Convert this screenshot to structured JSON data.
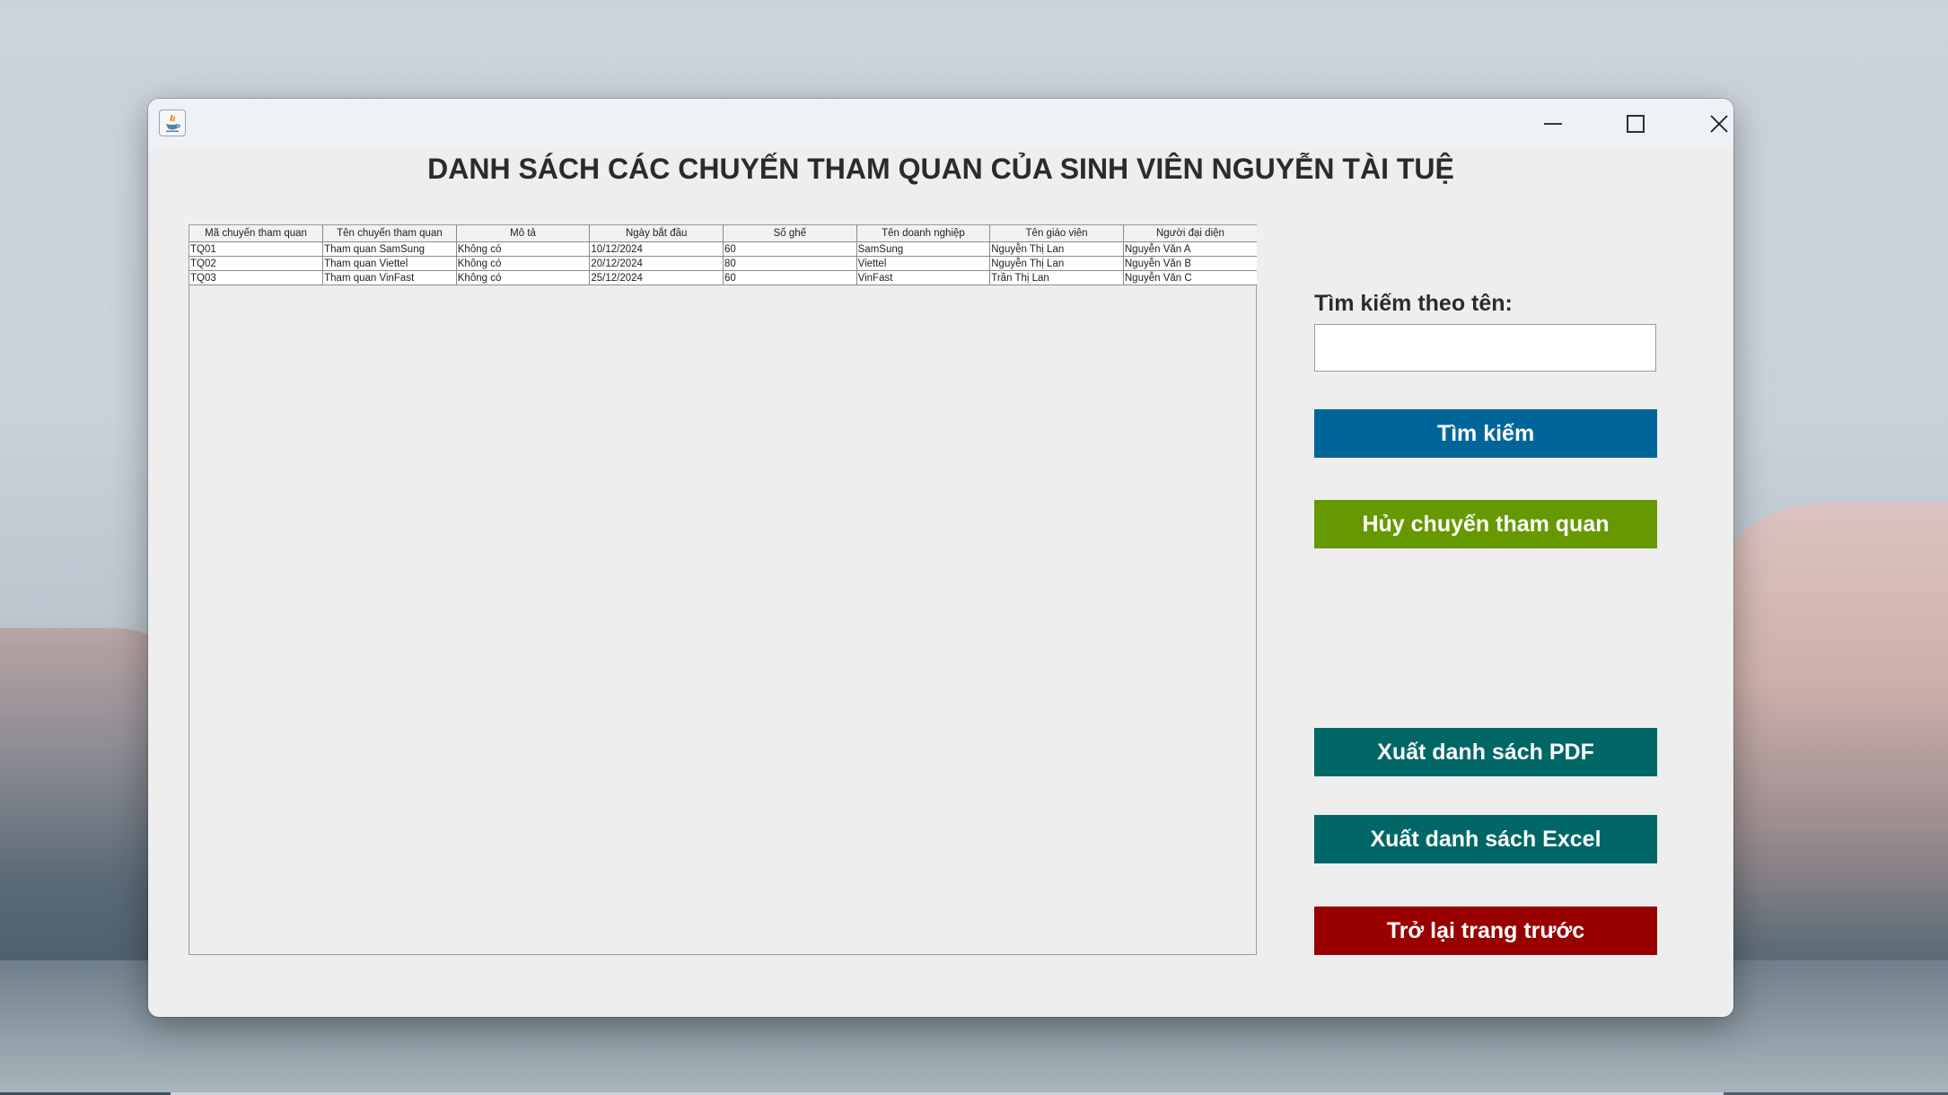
{
  "window": {
    "title": "",
    "controls": {
      "minimize": "minimize-icon",
      "maximize": "maximize-icon",
      "close": "close-icon"
    }
  },
  "page_title": "DANH SÁCH CÁC CHUYẾN THAM QUAN CỦA SINH VIÊN NGUYỄN TÀI TUỆ",
  "table": {
    "columns": [
      "Mã chuyến tham quan",
      "Tên chuyến tham quan",
      "Mô tả",
      "Ngày bắt đầu",
      "Số ghế",
      "Tên doanh nghiệp",
      "Tên giáo viên",
      "Người đại diện"
    ],
    "rows": [
      [
        "TQ01",
        "Tham quan SamSung",
        "Không có",
        "10/12/2024",
        "60",
        "SamSung",
        "Nguyễn Thị Lan",
        "Nguyễn Văn A"
      ],
      [
        "TQ02",
        "Tham quan Viettel",
        "Không có",
        "20/12/2024",
        "80",
        "Viettel",
        "Nguyễn Thị Lan",
        "Nguyễn Văn B"
      ],
      [
        "TQ03",
        "Tham quan VinFast",
        "Không có",
        "25/12/2024",
        "60",
        "VinFast",
        "Trần Thị Lan",
        "Nguyễn Văn C"
      ]
    ]
  },
  "search": {
    "label": "Tìm kiếm theo tên:",
    "value": "",
    "placeholder": ""
  },
  "buttons": {
    "search": "Tìm kiếm",
    "cancel_trip": "Hủy chuyến tham quan",
    "export_pdf": "Xuất danh sách PDF",
    "export_excel": "Xuất danh sách Excel",
    "back": "Trở lại trang trước"
  },
  "colors": {
    "search_button": "#006699",
    "cancel_button": "#669900",
    "export_buttons": "#006666",
    "back_button": "#990000"
  }
}
